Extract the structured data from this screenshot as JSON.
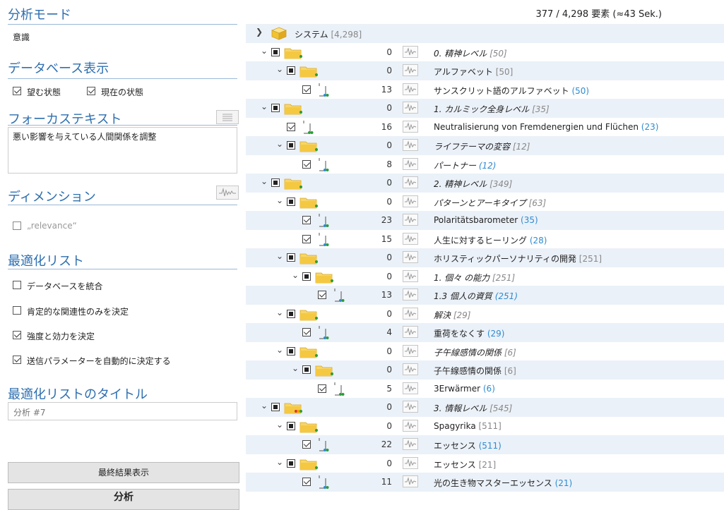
{
  "left": {
    "analysis_mode": {
      "title": "分析モード",
      "value": "意識"
    },
    "db_display": {
      "title": "データベース表示",
      "desired_label": "望む状態",
      "desired_checked": true,
      "current_label": "現在の状態",
      "current_checked": true
    },
    "focus_text": {
      "title": "フォーカステキスト",
      "value": "悪い影響を与えている人間関係を調整"
    },
    "dimension": {
      "title": "ディメンション",
      "relevance_label": "„relevance“",
      "relevance_checked": false
    },
    "optimization": {
      "title": "最適化リスト",
      "options": [
        {
          "label": "データベースを統合",
          "checked": false
        },
        {
          "label": "肯定的な関連性のみを決定",
          "checked": false
        },
        {
          "label": "強度と効力を決定",
          "checked": true
        },
        {
          "label": "送信パラメーターを自動的に決定する",
          "checked": true
        }
      ]
    },
    "list_title": {
      "title": "最適化リストのタイトル",
      "value": "分析 #7"
    },
    "show_results_label": "最終結果表示",
    "analyze_label": "分析"
  },
  "right": {
    "count": "377 / 4,298 要素 (≈43 Sek.)",
    "root": {
      "label": "システム",
      "count": "[4,298]"
    },
    "rows": [
      {
        "level": 1,
        "kind": "folder",
        "state": "partial",
        "num": "0",
        "label": "0. 精神レベル",
        "count": "[50]",
        "italic": true,
        "dots": "green"
      },
      {
        "level": 2,
        "kind": "folder",
        "state": "partial",
        "num": "0",
        "label": "アルファベット",
        "count": "[50]",
        "italic": false,
        "dots": "green"
      },
      {
        "level": 3,
        "kind": "leaf",
        "state": "checked",
        "num": "13",
        "label": "サンスクリット語のアルファベット",
        "count": "(50)",
        "italic": false,
        "dots": "bluegreen"
      },
      {
        "level": 1,
        "kind": "folder",
        "state": "partial",
        "num": "0",
        "label": "1. カルミック全身レベル",
        "count": "[35]",
        "italic": true,
        "dots": "green"
      },
      {
        "level": 2,
        "kind": "leaf",
        "state": "checked",
        "num": "16",
        "label": "Neutralisierung von Fremdenergien und Flüchen",
        "count": "(23)",
        "italic": false,
        "dots": "green"
      },
      {
        "level": 2,
        "kind": "folder",
        "state": "partial",
        "num": "0",
        "label": "ライフテーマの変容",
        "count": "[12]",
        "italic": true,
        "dots": "green"
      },
      {
        "level": 3,
        "kind": "leaf",
        "state": "checked",
        "num": "8",
        "label": "パートナー",
        "count": "(12)",
        "italic": true,
        "dots": "bluegreen"
      },
      {
        "level": 1,
        "kind": "folder",
        "state": "partial",
        "num": "0",
        "label": "2. 精神レベル",
        "count": "[349]",
        "italic": true,
        "dots": "green"
      },
      {
        "level": 2,
        "kind": "folder",
        "state": "partial",
        "num": "0",
        "label": "パターンとアーキタイプ",
        "count": "[63]",
        "italic": true,
        "dots": "green"
      },
      {
        "level": 3,
        "kind": "leaf",
        "state": "checked",
        "num": "23",
        "label": "Polaritätsbarometer",
        "count": "(35)",
        "italic": false,
        "dots": "bluegreen"
      },
      {
        "level": 3,
        "kind": "leaf",
        "state": "checked",
        "num": "15",
        "label": "人生に対するヒーリング",
        "count": "(28)",
        "italic": false,
        "dots": "bluegreen"
      },
      {
        "level": 2,
        "kind": "folder",
        "state": "partial",
        "num": "0",
        "label": "ホリスティックパーソナリティの開発",
        "count": "[251]",
        "italic": false,
        "dots": "green"
      },
      {
        "level": 3,
        "kind": "folder",
        "state": "partial",
        "num": "0",
        "label": "1. 個々 の能力",
        "count": "[251]",
        "italic": true,
        "dots": "green"
      },
      {
        "level": 4,
        "kind": "leaf",
        "state": "checked",
        "num": "13",
        "label": "1.3 個人の資質",
        "count": "(251)",
        "italic": true,
        "dots": "bluegreen"
      },
      {
        "level": 2,
        "kind": "folder",
        "state": "partial",
        "num": "0",
        "label": "解決",
        "count": "[29]",
        "italic": true,
        "dots": "green"
      },
      {
        "level": 3,
        "kind": "leaf",
        "state": "checked",
        "num": "4",
        "label": "重荷をなくす",
        "count": "(29)",
        "italic": false,
        "dots": "bluegreen"
      },
      {
        "level": 2,
        "kind": "folder",
        "state": "partial",
        "num": "0",
        "label": "子午線感情の関係",
        "count": "[6]",
        "italic": true,
        "dots": "green"
      },
      {
        "level": 3,
        "kind": "folder",
        "state": "partial",
        "num": "0",
        "label": "子午線感情の関係",
        "count": "[6]",
        "italic": false,
        "dots": "green"
      },
      {
        "level": 4,
        "kind": "leaf",
        "state": "checked",
        "num": "5",
        "label": "3Erwärmer",
        "count": "(6)",
        "italic": false,
        "dots": "green"
      },
      {
        "level": 1,
        "kind": "folder",
        "state": "partial",
        "num": "0",
        "label": "3. 情報レベル",
        "count": "[545]",
        "italic": true,
        "dots": "red"
      },
      {
        "level": 2,
        "kind": "folder",
        "state": "partial",
        "num": "0",
        "label": "Spagyrika",
        "count": "[511]",
        "italic": false,
        "dots": "green"
      },
      {
        "level": 3,
        "kind": "leaf",
        "state": "checked",
        "num": "22",
        "label": "エッセンス",
        "count": "(511)",
        "italic": false,
        "dots": "bluegreen"
      },
      {
        "level": 2,
        "kind": "folder",
        "state": "partial",
        "num": "0",
        "label": "エッセンス",
        "count": "[21]",
        "italic": false,
        "dots": "green"
      },
      {
        "level": 3,
        "kind": "leaf",
        "state": "checked",
        "num": "11",
        "label": "光の生き物マスターエッセンス",
        "count": "(21)",
        "italic": false,
        "dots": "bluegreen"
      }
    ]
  },
  "colors": {
    "accent": "#2e6fb0",
    "count_blue": "#2f8bd0",
    "folder": "#f5c842",
    "row_alt": "#ebf1f8"
  }
}
